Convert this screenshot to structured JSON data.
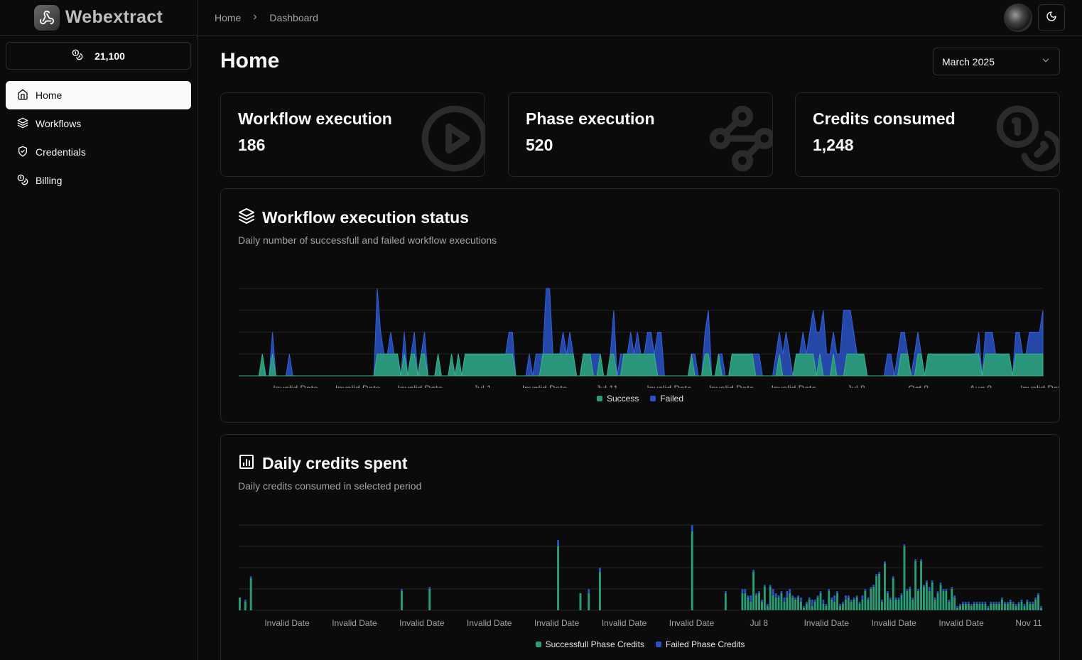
{
  "brand": {
    "name": "Webextract"
  },
  "sidebar": {
    "credits": "21,100",
    "items": [
      {
        "label": "Home",
        "icon": "home-icon",
        "active": true
      },
      {
        "label": "Workflows",
        "icon": "layers-icon"
      },
      {
        "label": "Credentials",
        "icon": "shield-check-icon"
      },
      {
        "label": "Billing",
        "icon": "coins-icon"
      }
    ]
  },
  "breadcrumb": {
    "items": [
      "Home",
      "Dashboard"
    ]
  },
  "page": {
    "title": "Home",
    "period": "March 2025"
  },
  "stats": [
    {
      "title": "Workflow execution",
      "value": "186",
      "icon": "circle-play-icon"
    },
    {
      "title": "Phase execution",
      "value": "520",
      "icon": "waypoints-icon"
    },
    {
      "title": "Credits consumed",
      "value": "1,248",
      "icon": "coins-icon"
    }
  ],
  "colors": {
    "success": "#2a9d74",
    "failed": "#2952c4"
  },
  "status_panel": {
    "title": "Workflow execution status",
    "subtitle": "Daily number of successfull and failed workflow executions",
    "icon": "layers-icon"
  },
  "credits_panel": {
    "title": "Daily credits spent",
    "subtitle": "Daily credits consumed in selected period",
    "icon": "chart-column-icon"
  },
  "chart_data": [
    {
      "type": "area",
      "stacked": true,
      "x_tick_labels": [
        "Invalid Date",
        "Invalid Date",
        "Invalid Date",
        "Jul 1",
        "Invalid Date",
        "Jul 11",
        "Invalid Date",
        "Invalid Date",
        "Invalid Date",
        "Jul 8",
        "Oct 8",
        "Aug 9",
        "Invalid Date"
      ],
      "series": [
        {
          "name": "Success",
          "values": [
            0,
            0,
            0,
            0,
            0,
            0,
            0,
            1,
            0,
            0,
            1,
            0,
            0,
            0,
            0,
            0,
            0,
            0,
            0,
            0,
            0,
            0,
            0,
            0,
            0,
            0,
            0,
            0,
            0,
            0,
            0,
            0,
            0,
            0,
            0,
            0,
            0,
            0,
            0,
            0,
            0,
            1,
            1,
            1,
            1,
            1,
            1,
            1,
            0,
            1,
            0,
            1,
            1,
            0,
            1,
            1,
            0,
            0,
            0,
            1,
            0,
            0,
            0,
            1,
            0,
            1,
            0,
            1,
            1,
            1,
            1,
            1,
            1,
            1,
            1,
            1,
            1,
            1,
            1,
            1,
            1,
            1,
            0,
            0,
            0,
            0,
            0,
            0,
            0,
            0,
            1,
            1,
            1,
            1,
            1,
            1,
            1,
            1,
            1,
            1,
            0,
            0,
            1,
            1,
            1,
            0,
            0,
            1,
            0,
            0,
            1,
            1,
            0,
            0,
            1,
            1,
            1,
            1,
            1,
            1,
            1,
            1,
            1,
            1,
            0,
            0,
            0,
            0,
            0,
            0,
            0,
            0,
            0,
            0,
            1,
            0,
            0,
            0,
            1,
            1,
            0,
            0,
            1,
            0,
            0,
            0,
            1,
            1,
            1,
            1,
            1,
            1,
            1,
            0,
            0,
            0,
            0,
            0,
            0,
            0,
            1,
            0,
            0,
            0,
            0,
            1,
            1,
            1,
            1,
            1,
            1,
            0,
            1,
            0,
            0,
            0,
            1,
            0,
            0,
            0,
            1,
            1,
            1,
            1,
            1,
            1,
            0,
            0,
            0,
            0,
            0,
            0,
            0,
            0,
            0,
            0,
            1,
            1,
            1,
            0,
            0,
            1,
            1,
            0,
            1,
            1,
            1,
            1,
            1,
            1,
            1,
            1,
            1,
            1,
            1,
            1,
            1,
            1,
            1,
            1,
            0,
            1,
            1,
            1,
            1,
            1,
            1,
            1,
            1,
            0,
            1,
            1,
            1,
            1,
            1,
            1,
            1,
            1,
            1
          ]
        },
        {
          "name": "Failed",
          "values": [
            0,
            0,
            0,
            0,
            0,
            0,
            0,
            0,
            0,
            0,
            1,
            0,
            0,
            0,
            0,
            1,
            0,
            0,
            0,
            0,
            0,
            0,
            0,
            0,
            0,
            0,
            0,
            0,
            0,
            0,
            0,
            0,
            0,
            0,
            0,
            0,
            0,
            0,
            0,
            0,
            0,
            3,
            1,
            0,
            0,
            1,
            0,
            0,
            0,
            1,
            0,
            0,
            1,
            0,
            0,
            1,
            0,
            0,
            0,
            0,
            0,
            0,
            0,
            0,
            0,
            0,
            0,
            0,
            0,
            0,
            0,
            0,
            0,
            0,
            0,
            0,
            0,
            0,
            0,
            0,
            1,
            1,
            0,
            0,
            0,
            0,
            1,
            0,
            1,
            1,
            0,
            3,
            3,
            0,
            0,
            0,
            1,
            0,
            1,
            0,
            0,
            0,
            0,
            0,
            0,
            1,
            1,
            0,
            0,
            0,
            0,
            2,
            0,
            1,
            0,
            0,
            1,
            0,
            1,
            0,
            0,
            1,
            1,
            0,
            2,
            2,
            0,
            0,
            0,
            0,
            0,
            0,
            0,
            0,
            0,
            1,
            0,
            0,
            1,
            2,
            0,
            0,
            0,
            1,
            0,
            0,
            0,
            0,
            0,
            0,
            0,
            0,
            0,
            1,
            1,
            0,
            0,
            0,
            0,
            1,
            1,
            1,
            2,
            1,
            0,
            0,
            0,
            1,
            0,
            1,
            2,
            2,
            1,
            3,
            1,
            1,
            1,
            1,
            1,
            3,
            2,
            2,
            1,
            0,
            0,
            0,
            0,
            0,
            0,
            0,
            0,
            0,
            1,
            1,
            0,
            1,
            1,
            1,
            0,
            0,
            1,
            1,
            0,
            0,
            0,
            0,
            0,
            0,
            0,
            0,
            0,
            0,
            0,
            0,
            0,
            0,
            0,
            0,
            0,
            1,
            0,
            1,
            1,
            1,
            0,
            0,
            0,
            0,
            0,
            0,
            1,
            1,
            0,
            0,
            1,
            1,
            1,
            1,
            2,
            1,
            0,
            0,
            0,
            0,
            0
          ]
        }
      ],
      "legend": [
        "Success",
        "Failed"
      ],
      "legend_position": "bottom-center",
      "grid": "horizontal"
    },
    {
      "type": "bar",
      "stacked": true,
      "x_tick_labels": [
        "Invalid Date",
        "Invalid Date",
        "Invalid Date",
        "Invalid Date",
        "Invalid Date",
        "Invalid Date",
        "Invalid Date",
        "Jul 8",
        "Invalid Date",
        "Invalid Date",
        "Invalid Date",
        "Nov 11"
      ],
      "series": [
        {
          "name": "Successfull Phase Credits",
          "values": [
            6,
            0,
            4,
            0,
            15,
            0,
            0,
            0,
            0,
            0,
            0,
            0,
            0,
            0,
            0,
            0,
            0,
            0,
            0,
            0,
            0,
            0,
            0,
            0,
            0,
            0,
            0,
            0,
            0,
            0,
            0,
            0,
            0,
            0,
            0,
            0,
            0,
            0,
            0,
            0,
            0,
            0,
            0,
            0,
            0,
            0,
            0,
            0,
            0,
            0,
            0,
            0,
            0,
            0,
            0,
            0,
            0,
            0,
            9,
            0,
            0,
            0,
            0,
            0,
            0,
            0,
            0,
            0,
            10,
            0,
            0,
            0,
            0,
            0,
            0,
            0,
            0,
            0,
            0,
            0,
            0,
            0,
            0,
            0,
            0,
            0,
            0,
            0,
            0,
            0,
            0,
            0,
            0,
            0,
            0,
            0,
            0,
            0,
            0,
            0,
            0,
            0,
            0,
            0,
            0,
            0,
            0,
            0,
            0,
            0,
            0,
            0,
            0,
            0,
            30,
            0,
            0,
            0,
            0,
            0,
            0,
            0,
            8,
            0,
            0,
            8,
            0,
            0,
            0,
            18,
            0,
            0,
            0,
            0,
            0,
            0,
            0,
            0,
            0,
            0,
            0,
            0,
            0,
            0,
            0,
            0,
            0,
            0,
            0,
            0,
            0,
            0,
            0,
            0,
            0,
            0,
            0,
            0,
            0,
            0,
            0,
            0,
            37,
            0,
            0,
            0,
            0,
            0,
            0,
            0,
            0,
            0,
            0,
            0,
            8,
            0,
            0,
            0,
            0,
            0,
            8,
            8,
            6,
            4,
            18,
            7,
            8,
            4,
            11,
            2,
            11,
            7,
            6,
            6,
            8,
            4,
            6,
            8,
            6,
            5,
            6,
            4,
            1,
            3,
            5,
            2,
            4,
            6,
            8,
            3,
            2,
            9,
            5,
            4,
            8,
            2,
            3,
            5,
            6,
            4,
            5,
            6,
            3,
            5,
            9,
            5,
            10,
            11,
            16,
            17,
            4,
            22,
            8,
            5,
            15,
            5,
            5,
            7,
            30,
            9,
            10,
            5,
            23,
            9,
            23,
            11,
            13,
            9,
            13,
            5,
            8,
            12,
            9,
            9,
            4,
            10,
            6,
            1,
            2,
            3,
            3,
            3,
            2,
            3,
            3,
            3,
            3,
            3,
            1,
            3,
            3,
            3,
            3,
            5,
            3,
            3,
            4,
            3,
            2,
            3,
            4,
            2,
            4,
            3,
            3,
            5,
            7,
            1
          ]
        },
        {
          "name": "Failed Phase Credits",
          "values": [
            0,
            0,
            1,
            0,
            1,
            0,
            0,
            0,
            0,
            0,
            0,
            0,
            0,
            0,
            0,
            0,
            0,
            0,
            0,
            0,
            0,
            0,
            0,
            0,
            0,
            0,
            0,
            0,
            0,
            0,
            0,
            0,
            0,
            0,
            0,
            0,
            0,
            0,
            0,
            0,
            0,
            0,
            0,
            0,
            0,
            0,
            0,
            0,
            0,
            0,
            0,
            0,
            0,
            0,
            0,
            0,
            0,
            0,
            1,
            0,
            0,
            0,
            0,
            0,
            0,
            0,
            0,
            0,
            1,
            0,
            0,
            0,
            0,
            0,
            0,
            0,
            0,
            0,
            0,
            0,
            0,
            0,
            0,
            0,
            0,
            0,
            0,
            0,
            0,
            0,
            0,
            0,
            0,
            0,
            0,
            0,
            0,
            0,
            0,
            0,
            0,
            0,
            0,
            0,
            0,
            0,
            0,
            0,
            0,
            0,
            0,
            0,
            0,
            0,
            3,
            0,
            0,
            0,
            0,
            0,
            0,
            0,
            0,
            0,
            0,
            2,
            0,
            0,
            0,
            2,
            0,
            0,
            0,
            0,
            0,
            0,
            0,
            0,
            0,
            0,
            0,
            0,
            0,
            0,
            0,
            0,
            0,
            0,
            0,
            0,
            0,
            0,
            0,
            0,
            0,
            0,
            0,
            0,
            0,
            0,
            0,
            0,
            3,
            0,
            0,
            0,
            0,
            0,
            0,
            0,
            0,
            0,
            0,
            0,
            1,
            0,
            0,
            0,
            0,
            0,
            2,
            2,
            1,
            3,
            1,
            1,
            1,
            1,
            1,
            1,
            1,
            3,
            2,
            1,
            1,
            2,
            3,
            2,
            1,
            1,
            1,
            2,
            1,
            1,
            1,
            3,
            1,
            1,
            1,
            2,
            1,
            1,
            1,
            3,
            1,
            1,
            1,
            2,
            1,
            1,
            1,
            1,
            1,
            2,
            1,
            1,
            1,
            1,
            1,
            1,
            1,
            1,
            1,
            1,
            1,
            1,
            1,
            1,
            1,
            1,
            1,
            1,
            1,
            1,
            1,
            1,
            1,
            2,
            1,
            1,
            1,
            1,
            1,
            1,
            1,
            1,
            1,
            1,
            1,
            1,
            1,
            1,
            1,
            1,
            1,
            1,
            1,
            1,
            1,
            1,
            1,
            1,
            1,
            1,
            1,
            1,
            1,
            1,
            1,
            1,
            1,
            1,
            1,
            1,
            1,
            1,
            1,
            1,
            1,
            1,
            1,
            1,
            1,
            1
          ]
        }
      ],
      "legend": [
        "Successfull Phase Credits",
        "Failed Phase Credits"
      ],
      "legend_position": "bottom-center",
      "grid": "horizontal"
    }
  ]
}
